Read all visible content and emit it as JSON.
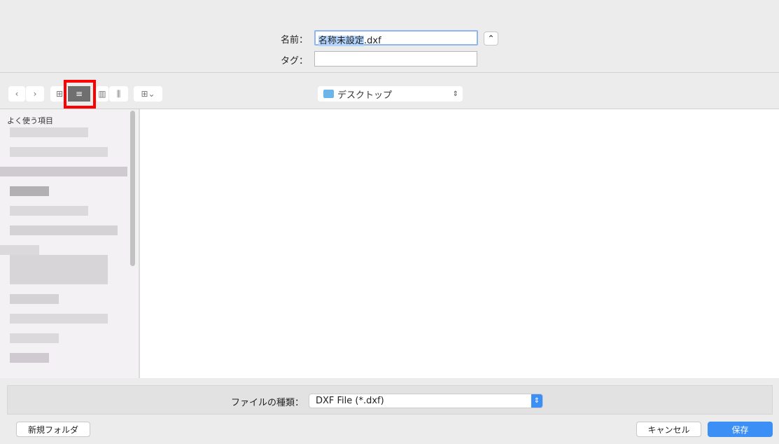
{
  "name_label": "名前：",
  "name_value_selected": "名称未設定",
  "name_value_ext": ".dxf",
  "tag_label": "タグ：",
  "tag_value": "",
  "location": "デスクトップ",
  "sidebar_heading": "よく使う項目",
  "filetype_label": "ファイルの種類：",
  "filetype_value": "DXF File (*.dxf)",
  "new_folder": "新規フォルダ",
  "cancel": "キャンセル",
  "save": "保存",
  "accent": "#3b8ff5",
  "highlight": "#ff0000"
}
